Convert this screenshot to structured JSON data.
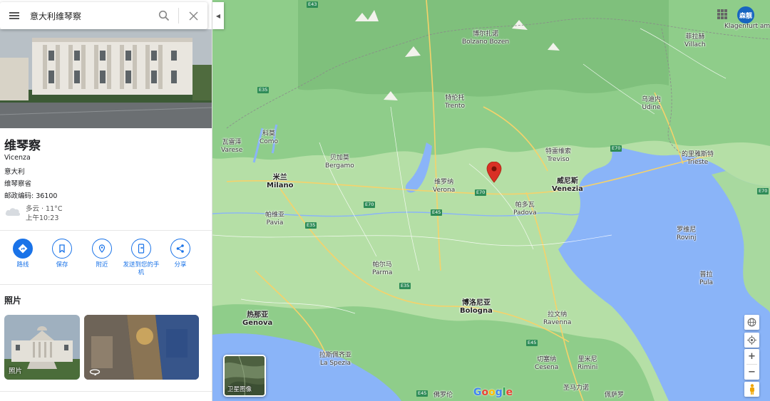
{
  "search": {
    "query": "意大利维琴察"
  },
  "place": {
    "title": "维琴察",
    "address_lines": [
      "Vicenza",
      "意大利",
      "维琴察省",
      "邮政编码: 36100"
    ],
    "weather": {
      "condition": "多云 · 11°C",
      "time": "上午10:23"
    }
  },
  "actions": [
    {
      "label": "路线",
      "icon": "directions-icon"
    },
    {
      "label": "保存",
      "icon": "bookmark-icon"
    },
    {
      "label": "附近",
      "icon": "nearby-icon"
    },
    {
      "label": "发送到您的手机",
      "icon": "send-to-phone-icon"
    },
    {
      "label": "分享",
      "icon": "share-icon"
    }
  ],
  "photos": {
    "heading": "照片",
    "thumbs": [
      {
        "label": "照片"
      },
      {
        "label": ""
      }
    ]
  },
  "map": {
    "layers_label": "卫星图像",
    "logo": "Google",
    "avatar_text": "森靓",
    "cities": [
      {
        "zh": "博尔扎诺",
        "en": "Bolzano Bozen"
      },
      {
        "zh": "特伦托",
        "en": "Trento"
      },
      {
        "zh": "瓦雷泽",
        "en": "Varese"
      },
      {
        "zh": "科莫",
        "en": "Como"
      },
      {
        "zh": "贝加莫",
        "en": "Bergamo"
      },
      {
        "zh": "米兰",
        "en": "Milano"
      },
      {
        "zh": "维罗纳",
        "en": "Verona"
      },
      {
        "zh": "特雷维索",
        "en": "Treviso"
      },
      {
        "zh": "威尼斯",
        "en": "Venezia"
      },
      {
        "zh": "帕多瓦",
        "en": "Padova"
      },
      {
        "zh": "帕维亚",
        "en": "Pavia"
      },
      {
        "zh": "帕尔马",
        "en": "Parma"
      },
      {
        "zh": "博洛尼亚",
        "en": "Bologna"
      },
      {
        "zh": "热那亚",
        "en": "Genova"
      },
      {
        "zh": "拉斯佩齐亚",
        "en": "La Spezia"
      },
      {
        "zh": "拉文纳",
        "en": "Ravenna"
      },
      {
        "zh": "切塞纳",
        "en": "Cesena"
      },
      {
        "zh": "里米尼",
        "en": "Rimini"
      },
      {
        "zh": "乌迪内",
        "en": "Udine"
      },
      {
        "zh": "的里雅斯特",
        "en": "Trieste"
      },
      {
        "zh": "菲拉赫",
        "en": "Villach"
      },
      {
        "zh": "罗维尼",
        "en": "Rovinj"
      },
      {
        "zh": "普拉",
        "en": "Pula"
      },
      {
        "zh": "圣马力诺",
        "en": ""
      },
      {
        "zh": "佛罗伦",
        "en": ""
      },
      {
        "zh": "佩萨罗",
        "en": ""
      },
      {
        "zh": "",
        "en": "Klagenfurt am Wörthersee"
      }
    ],
    "roads": [
      "E43",
      "E35",
      "E70",
      "E70",
      "E70",
      "E45",
      "E35",
      "E35",
      "E45",
      "E45",
      "E70"
    ]
  },
  "colors": {
    "accent": "#1a73e8",
    "pin": "#d93025",
    "land": "#a3d7a0",
    "sea": "#8ab4f8"
  }
}
